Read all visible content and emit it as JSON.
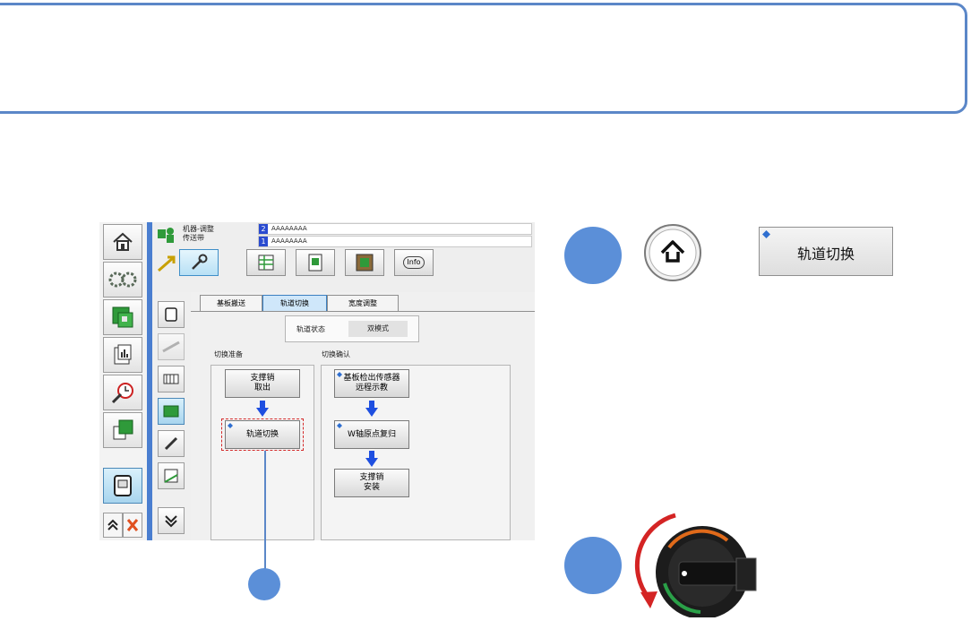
{
  "colors": {
    "accent": "#5b87c8",
    "badge": "#5b8fd8",
    "highlight": "#d42b2b"
  },
  "header": {
    "group_line1": "机器-调整",
    "group_line2": "传送带",
    "id_line1": "AAAAAAAA",
    "id_line2": "AAAAAAAA",
    "info_label": "Info"
  },
  "tabs": [
    "基板搬送",
    "轨道切换",
    "宽度调整"
  ],
  "status": {
    "label": "轨道状态",
    "value": "双模式"
  },
  "prep": {
    "title": "切换准备",
    "step1": "支撑销\n取出",
    "step2": "轨道切换"
  },
  "confirm": {
    "title": "切换确认",
    "step1": "基板检出传感器\n远程示教",
    "step2": "W轴原点复归",
    "step3": "支撑销\n安装"
  },
  "callout": {
    "button_label": "轨道切换"
  }
}
